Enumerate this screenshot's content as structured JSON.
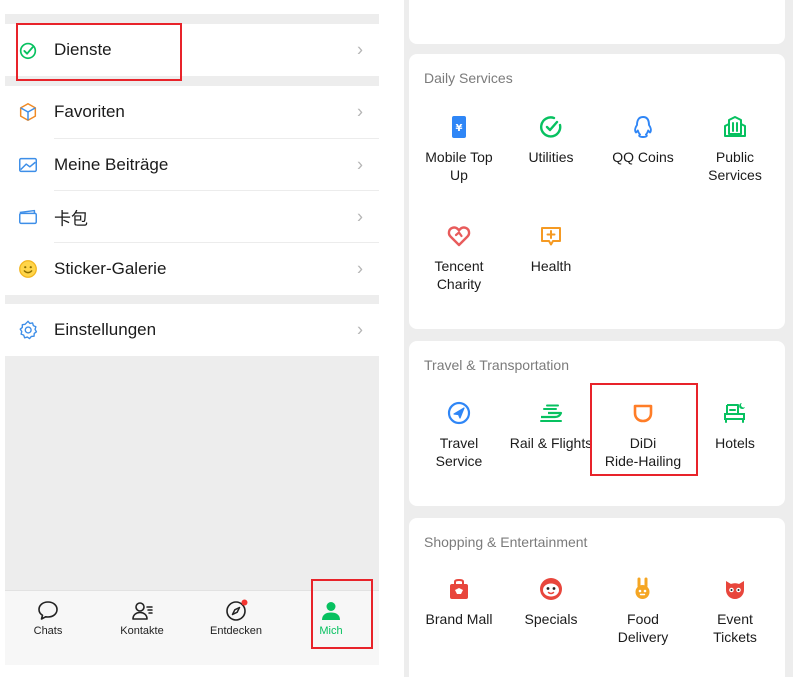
{
  "left_menu": {
    "items": [
      {
        "label": "Dienste",
        "icon": "services-icon"
      },
      {
        "label": "Favoriten",
        "icon": "favorites-icon"
      },
      {
        "label": "Meine Beiträge",
        "icon": "moments-icon"
      },
      {
        "label": "卡包",
        "icon": "card-wallet-icon"
      },
      {
        "label": "Sticker-Galerie",
        "icon": "sticker-icon"
      },
      {
        "label": "Einstellungen",
        "icon": "settings-icon"
      }
    ],
    "chevron": "›"
  },
  "tabbar": {
    "tabs": [
      {
        "label": "Chats",
        "icon": "chat-bubble-icon"
      },
      {
        "label": "Kontakte",
        "icon": "contacts-icon"
      },
      {
        "label": "Entdecken",
        "icon": "compass-icon"
      },
      {
        "label": "Mich",
        "icon": "person-icon",
        "active": true
      }
    ]
  },
  "services": {
    "daily": {
      "title": "Daily Services",
      "items": [
        "Mobile Top\nUp",
        "Utilities",
        "QQ Coins",
        "Public\nServices",
        "Tencent\nCharity",
        "Health"
      ]
    },
    "travel": {
      "title": "Travel & Transportation",
      "items": [
        "Travel\nService",
        "Rail & Flights",
        "DiDi\nRide-Hailing",
        "Hotels"
      ]
    },
    "shopping": {
      "title": "Shopping & Entertainment",
      "items": [
        "Brand Mall",
        "Specials",
        "Food\nDelivery",
        "Event\nTickets"
      ]
    }
  },
  "colors": {
    "accent_green": "#07c160",
    "highlight_red": "#e8232a",
    "didi_orange": "#ff7d27"
  }
}
